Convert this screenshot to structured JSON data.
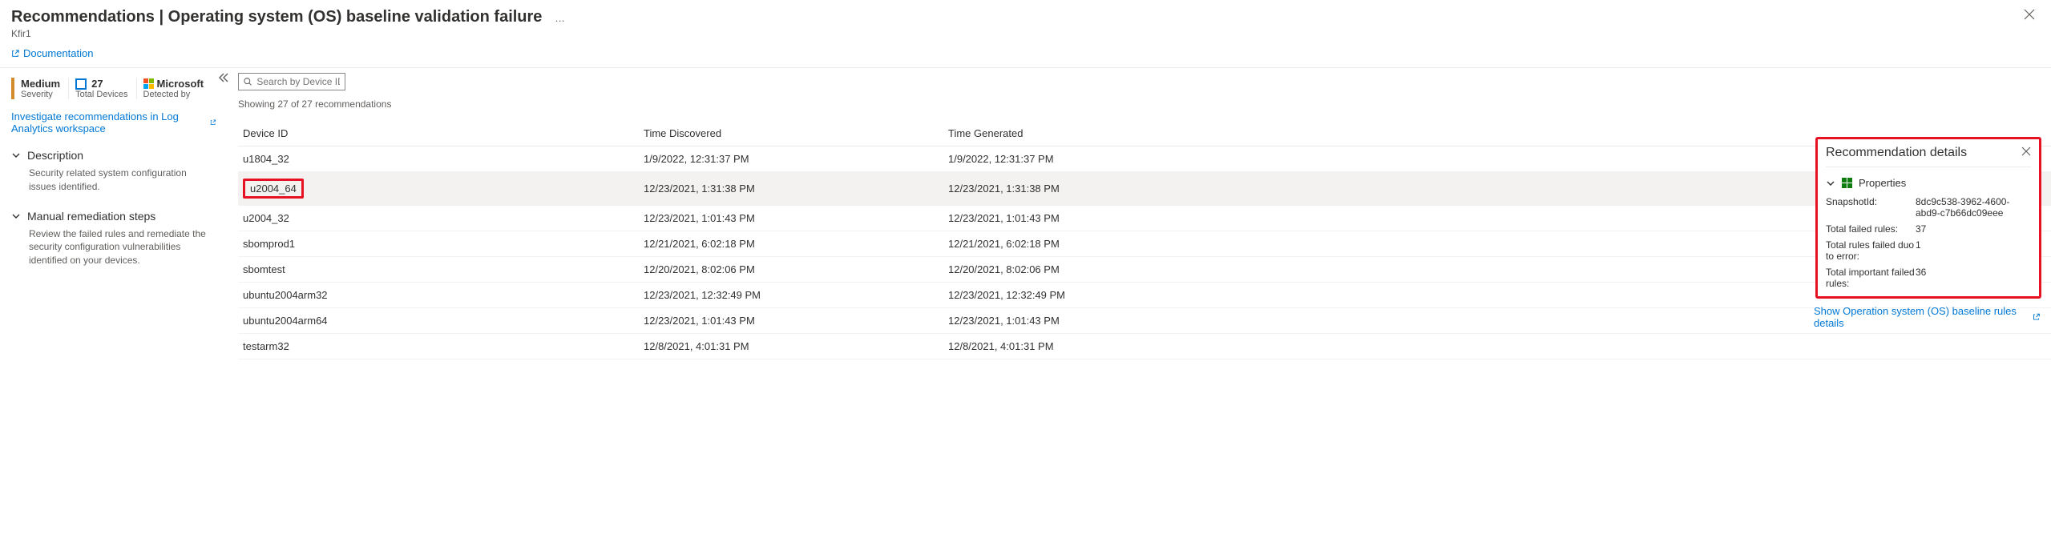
{
  "header": {
    "title": "Recommendations | Operating system (OS) baseline validation failure",
    "ellipsis": "…",
    "subtitle": "Kfir1",
    "doc_link": "Documentation"
  },
  "left": {
    "severity_label": "Medium",
    "severity_sub": "Severity",
    "total_devices_num": "27",
    "total_devices_label": "Total Devices",
    "detected_label": "Microsoft",
    "detected_sub": "Detected by",
    "workspace_link": "Investigate recommendations in Log Analytics workspace",
    "desc_title": "Description",
    "desc_body": "Security related system configuration issues identified.",
    "remediation_title": "Manual remediation steps",
    "remediation_body": "Review the failed rules and remediate the security configuration vulnerabilities identified on your devices."
  },
  "grid": {
    "search_placeholder": "Search by Device ID",
    "result_count": "Showing 27 of 27 recommendations",
    "columns": {
      "c1": "Device ID",
      "c2": "Time Discovered",
      "c3": "Time Generated"
    },
    "rows": [
      {
        "device": "u1804_32",
        "discovered": "1/9/2022, 12:31:37 PM",
        "generated": "1/9/2022, 12:31:37 PM",
        "selected": false,
        "highlight": false
      },
      {
        "device": "u2004_64",
        "discovered": "12/23/2021, 1:31:38 PM",
        "generated": "12/23/2021, 1:31:38 PM",
        "selected": true,
        "highlight": true
      },
      {
        "device": "u2004_32",
        "discovered": "12/23/2021, 1:01:43 PM",
        "generated": "12/23/2021, 1:01:43 PM",
        "selected": false,
        "highlight": false
      },
      {
        "device": "sbomprod1",
        "discovered": "12/21/2021, 6:02:18 PM",
        "generated": "12/21/2021, 6:02:18 PM",
        "selected": false,
        "highlight": false
      },
      {
        "device": "sbomtest",
        "discovered": "12/20/2021, 8:02:06 PM",
        "generated": "12/20/2021, 8:02:06 PM",
        "selected": false,
        "highlight": false
      },
      {
        "device": "ubuntu2004arm32",
        "discovered": "12/23/2021, 12:32:49 PM",
        "generated": "12/23/2021, 12:32:49 PM",
        "selected": false,
        "highlight": false
      },
      {
        "device": "ubuntu2004arm64",
        "discovered": "12/23/2021, 1:01:43 PM",
        "generated": "12/23/2021, 1:01:43 PM",
        "selected": false,
        "highlight": false
      },
      {
        "device": "testarm32",
        "discovered": "12/8/2021, 4:01:31 PM",
        "generated": "12/8/2021, 4:01:31 PM",
        "selected": false,
        "highlight": false
      }
    ]
  },
  "details": {
    "title": "Recommendation details",
    "props_label": "Properties",
    "kv": [
      {
        "k": "SnapshotId:",
        "v": "8dc9c538-3962-4600-abd9-c7b66dc09eee"
      },
      {
        "k": "Total failed rules:",
        "v": "37"
      },
      {
        "k": "Total rules failed duo to error:",
        "v": "1"
      },
      {
        "k": "Total important failed rules:",
        "v": "36"
      }
    ],
    "show_rules": "Show Operation system (OS) baseline rules details"
  }
}
